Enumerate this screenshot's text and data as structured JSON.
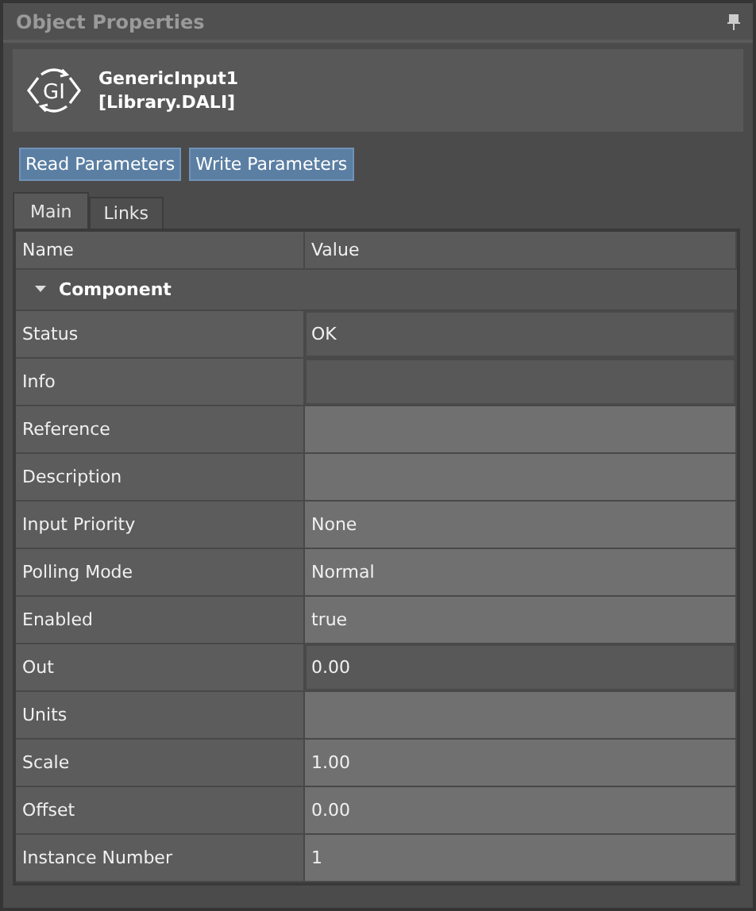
{
  "panel": {
    "title": "Object Properties"
  },
  "object": {
    "icon_text": "GI",
    "name": "GenericInput1",
    "library": "[Library.DALI]"
  },
  "buttons": [
    "Read Parameters",
    "Write Parameters"
  ],
  "tabs": [
    {
      "label": "Main",
      "selected": true
    },
    {
      "label": "Links",
      "selected": false
    }
  ],
  "grid": {
    "columns": [
      "Name",
      "Value"
    ],
    "category": {
      "label": "Component",
      "expanded": true
    },
    "rows": [
      {
        "name": "Status",
        "value": "OK",
        "readonly": true
      },
      {
        "name": "Info",
        "value": "",
        "readonly": true
      },
      {
        "name": "Reference",
        "value": "",
        "readonly": false
      },
      {
        "name": "Description",
        "value": "",
        "readonly": false
      },
      {
        "name": "Input Priority",
        "value": "None",
        "readonly": false
      },
      {
        "name": "Polling Mode",
        "value": "Normal",
        "readonly": false
      },
      {
        "name": "Enabled",
        "value": "true",
        "readonly": false
      },
      {
        "name": "Out",
        "value": "0.00",
        "readonly": true
      },
      {
        "name": "Units",
        "value": "",
        "readonly": false
      },
      {
        "name": "Scale",
        "value": "1.00",
        "readonly": false
      },
      {
        "name": "Offset",
        "value": "0.00",
        "readonly": false
      },
      {
        "name": "Instance Number",
        "value": "1",
        "readonly": false
      }
    ]
  }
}
